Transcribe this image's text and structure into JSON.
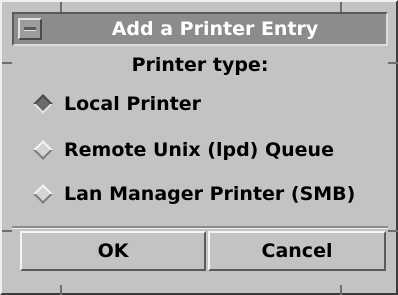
{
  "window": {
    "title": "Add a Printer Entry"
  },
  "dialog": {
    "heading": "Printer type:",
    "options": [
      {
        "label": "Local Printer",
        "selected": true
      },
      {
        "label": "Remote Unix (lpd) Queue",
        "selected": false
      },
      {
        "label": "Lan Manager Printer (SMB)",
        "selected": false
      }
    ]
  },
  "buttons": {
    "ok_label": "OK",
    "cancel_label": "Cancel"
  },
  "colors": {
    "background": "#c3c3c3",
    "titlebar": "#8c8c8c",
    "title_text": "#ffffff"
  }
}
